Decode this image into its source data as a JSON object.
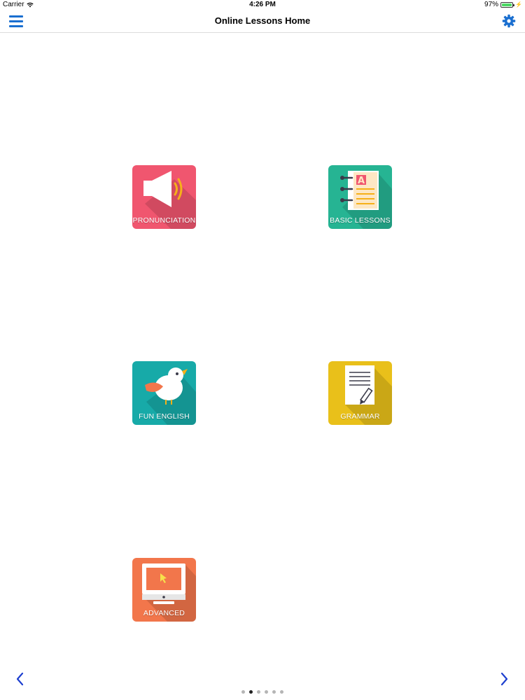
{
  "status_bar": {
    "carrier": "Carrier",
    "time": "4:26 PM",
    "battery_percent": "97%",
    "battery_level": 0.97
  },
  "nav": {
    "title": "Online Lessons Home",
    "menu_icon": "hamburger-menu-icon",
    "settings_icon": "gear-icon",
    "accent_color": "#1a6fd0"
  },
  "tiles": [
    {
      "label": "PRONUNCIATION",
      "icon": "speaker-icon",
      "color": "#f0566f"
    },
    {
      "label": "BASIC LESSONS",
      "icon": "notebook-icon",
      "color": "#26b493"
    },
    {
      "label": "FUN ENGLISH",
      "icon": "bird-icon",
      "color": "#17aaa8"
    },
    {
      "label": "GRAMMAR",
      "icon": "document-pencil-icon",
      "color": "#e9c01a"
    },
    {
      "label": "ADVANCED",
      "icon": "computer-monitor-icon",
      "color": "#f2764b"
    }
  ],
  "pager": {
    "page_count": 6,
    "active_index": 1,
    "prev_icon": "chevron-left-icon",
    "next_icon": "chevron-right-icon"
  }
}
